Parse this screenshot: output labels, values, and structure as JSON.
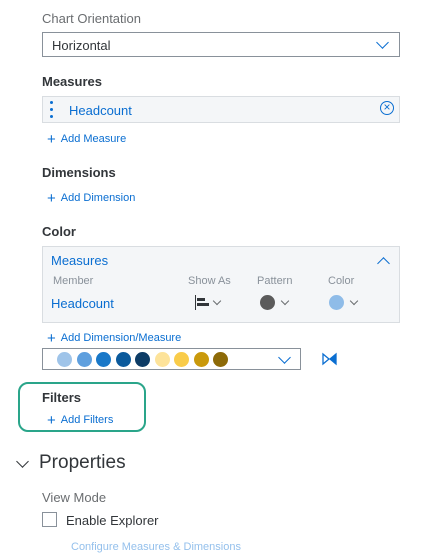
{
  "chart_orientation": {
    "label": "Chart Orientation",
    "value": "Horizontal"
  },
  "measures": {
    "heading": "Measures",
    "item": "Headcount",
    "add_label": "Add Measure"
  },
  "dimensions": {
    "heading": "Dimensions",
    "add_label": "Add Dimension"
  },
  "color": {
    "heading": "Color",
    "panel_title": "Measures",
    "columns": [
      "Member",
      "Show As",
      "Pattern",
      "Color"
    ],
    "row_member": "Headcount",
    "add_label": "Add Dimension/Measure",
    "palette": [
      "#9fc4e9",
      "#5e9fde",
      "#1978c8",
      "#0b5a9c",
      "#0d3c66",
      "#fde39a",
      "#f9cc4a",
      "#c9990c",
      "#8d6a08"
    ],
    "pattern_color": "#5b5b5b",
    "swatch_color": "#8fbce8"
  },
  "filters": {
    "heading": "Filters",
    "add_label": "Add Filters",
    "highlight_color": "#2aa58a"
  },
  "properties": {
    "heading": "Properties",
    "view_mode_label": "View Mode",
    "checkbox_label": "Enable Explorer",
    "configure_link": "Configure Measures & Dimensions"
  }
}
